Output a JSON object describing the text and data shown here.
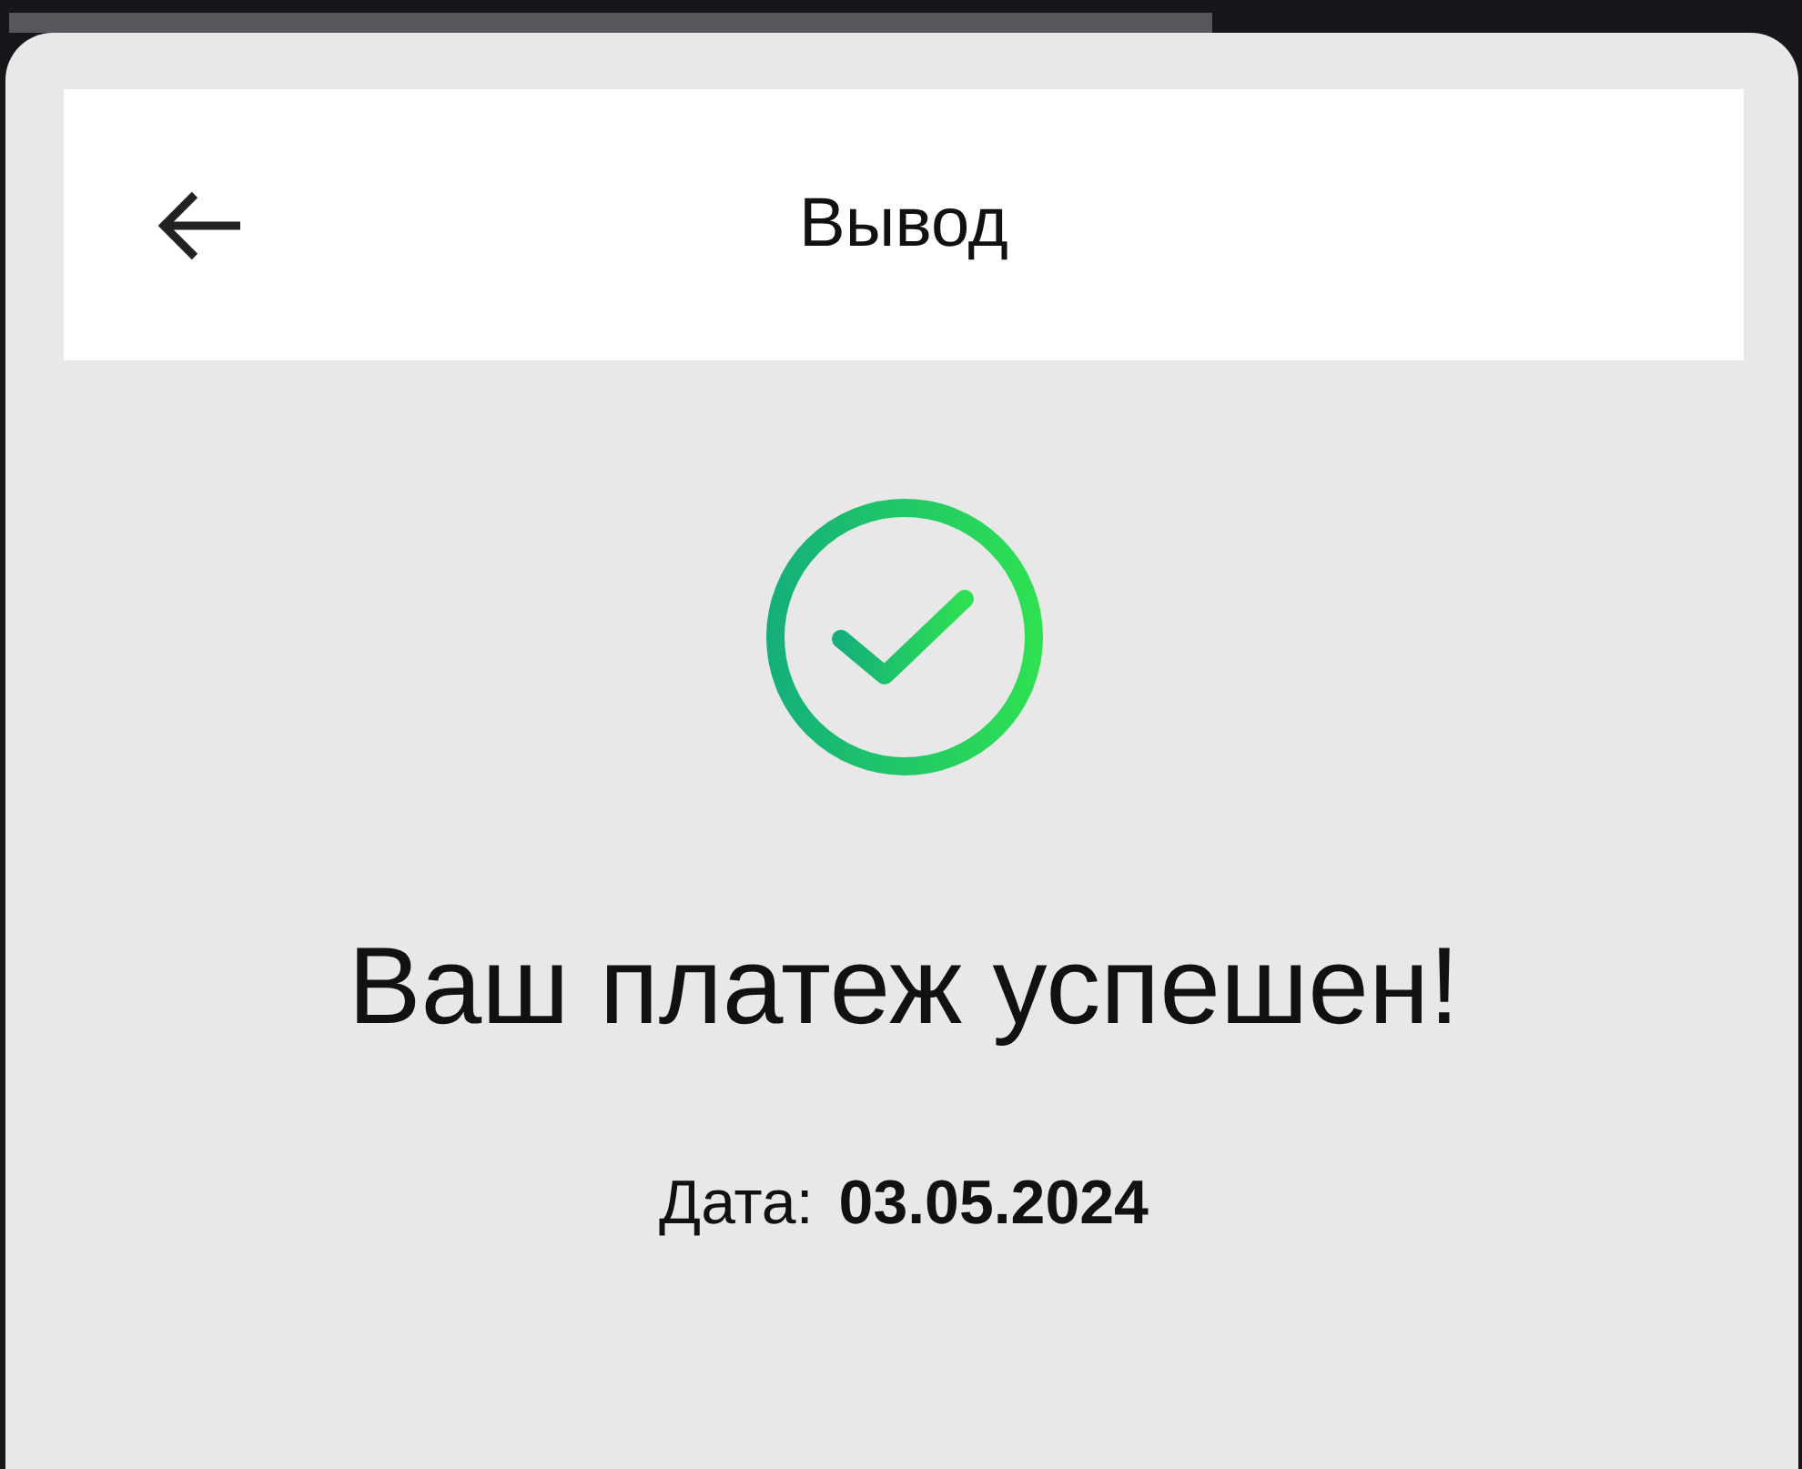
{
  "header": {
    "title": "Вывод"
  },
  "result": {
    "kind": "success",
    "message": "Ваш платеж успешен!"
  },
  "date": {
    "label": "Дата:",
    "value": "03.05.2024"
  }
}
